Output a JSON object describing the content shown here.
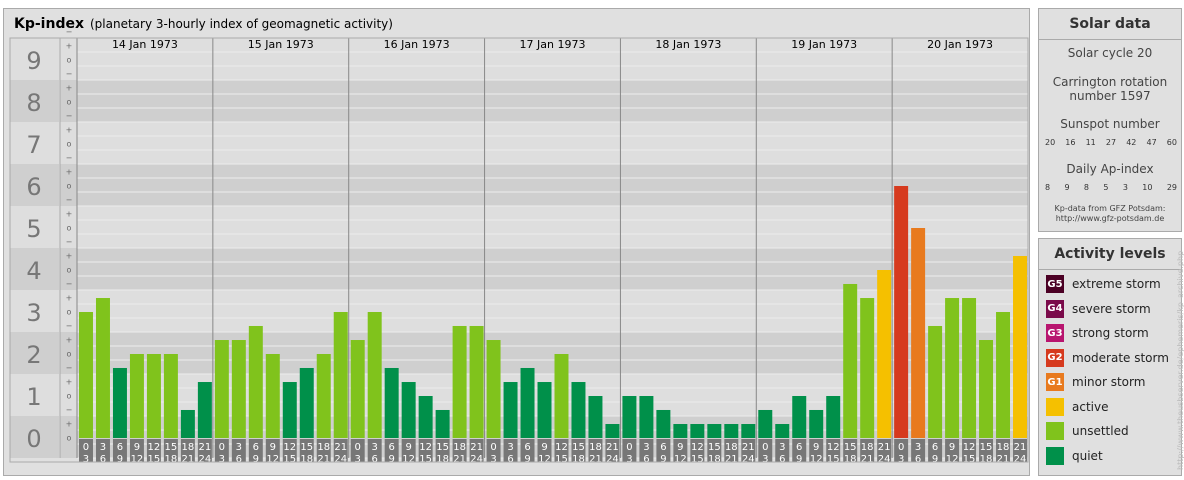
{
  "header": {
    "title": "Kp-index",
    "subtitle": "(planetary 3-hourly index of geomagnetic activity)"
  },
  "solar": {
    "title": "Solar data",
    "cycle": "Solar cycle 20",
    "rotation_line1": "Carrington rotation",
    "rotation_line2": "number 1597",
    "sunspot_label": "Sunspot number",
    "sunspot_values": [
      "20",
      "16",
      "11",
      "27",
      "42",
      "47",
      "60"
    ],
    "ap_label": "Daily Ap-index",
    "ap_values": [
      "8",
      "9",
      "8",
      "5",
      "3",
      "10",
      "29"
    ],
    "source_line1": "Kp-data from GFZ Potsdam:",
    "source_line2": "http://www.gfz-potsdam.de"
  },
  "activity": {
    "title": "Activity levels",
    "levels": [
      {
        "badge": "G5",
        "label": "extreme storm",
        "color": "#4b0024"
      },
      {
        "badge": "G4",
        "label": "severe storm",
        "color": "#7a0a4a"
      },
      {
        "badge": "G3",
        "label": "strong storm",
        "color": "#b8156f"
      },
      {
        "badge": "G2",
        "label": "moderate storm",
        "color": "#d63a1e"
      },
      {
        "badge": "G1",
        "label": "minor storm",
        "color": "#e87a1e"
      },
      {
        "badge": "",
        "label": "active",
        "color": "#f5c000"
      },
      {
        "badge": "",
        "label": "unsettled",
        "color": "#80c31c"
      },
      {
        "badge": "",
        "label": "quiet",
        "color": "#00904a"
      }
    ]
  },
  "watermark": "http://www.theusbserver.de/ephemeris/kp_archive.php",
  "chart_data": {
    "type": "bar",
    "title": "Kp-index",
    "ylim": [
      0,
      9
    ],
    "y_major_ticks": [
      "0",
      "1",
      "2",
      "3",
      "4",
      "5",
      "6",
      "7",
      "8",
      "9"
    ],
    "y_minor_ticks": [
      "o",
      "+",
      "−",
      "o",
      "+",
      "−"
    ],
    "days": [
      "14 Jan 1973",
      "15 Jan 1973",
      "16 Jan 1973",
      "17 Jan 1973",
      "18 Jan 1973",
      "19 Jan 1973",
      "20 Jan 1973"
    ],
    "interval_starts": [
      "0",
      "3",
      "6",
      "9",
      "12",
      "15",
      "18",
      "21"
    ],
    "interval_ends": [
      "3",
      "6",
      "9",
      "12",
      "15",
      "18",
      "21",
      "24"
    ],
    "values": [
      [
        3,
        3.333,
        1.667,
        2,
        2,
        2,
        0.667,
        1.333
      ],
      [
        2.333,
        2.333,
        2.667,
        2,
        1.333,
        1.667,
        2,
        3
      ],
      [
        2.333,
        3,
        1.667,
        1.333,
        1,
        0.667,
        2.667,
        2.667
      ],
      [
        2.333,
        1.333,
        1.667,
        1.333,
        2,
        1.333,
        1,
        0.333
      ],
      [
        1,
        1,
        0.667,
        0.333,
        0.333,
        0.333,
        0.333,
        0.333
      ],
      [
        0.667,
        0.333,
        1,
        0.667,
        1,
        3.667,
        3.333,
        4
      ],
      [
        6,
        5,
        2.667,
        3.333,
        3.333,
        2.333,
        3,
        4.333
      ]
    ],
    "grid": true
  }
}
